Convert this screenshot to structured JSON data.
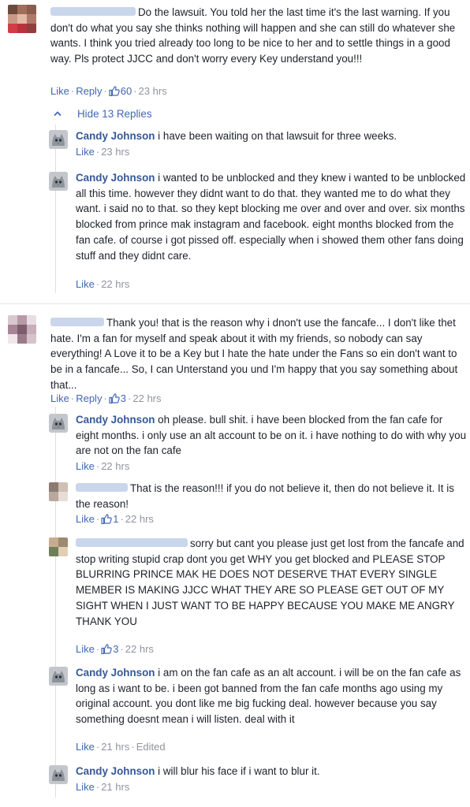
{
  "thread1": {
    "comment": {
      "text": "Do the lawsuit. You told her the last time it's the last warning. If you don't do what you say she thinks nothing will happen and she can still do whatever she wants. I think you tried already too long to be nice to her and to settle things in a good way. Pls protect JJCC and don't worry every Key understand you!!!",
      "like": "Like",
      "reply": "Reply",
      "likes": "60",
      "time": "23 hrs"
    },
    "hide_replies": "Hide 13 Replies",
    "replies": [
      {
        "author": "Candy Johnson",
        "text": "i have been waiting on that lawsuit for three weeks.",
        "like": "Like",
        "time": "23 hrs"
      },
      {
        "author": "Candy Johnson",
        "text": "i wanted to be unblocked and they knew i wanted to be unblocked all this time. however they didnt want to do that. they wanted me to do what they want. i said no to that. so they kept blocking me over and over and over. six months blocked from prince mak instagram and facebook. eight months blocked from the fan cafe. of course i got pissed off. especially when i showed them other fans doing stuff and they didnt care.",
        "like": "Like",
        "time": "22 hrs"
      }
    ]
  },
  "thread2": {
    "comment": {
      "text": "Thank you! that is the reason why i dnon't use the fancafe... I don't like thet hate. I'm a fan for myself and speak about it with my friends, so nobody can say everything! A Love it to be a Key but I hate the hate under the Fans so ein don't want to be in a fancafe... So, I can Unterstand you und I'm happy that you say something about that...",
      "like": "Like",
      "reply": "Reply",
      "likes": "3",
      "time": "22 hrs"
    },
    "replies": [
      {
        "author": "Candy Johnson",
        "text": "oh please. bull shit. i have been blocked from the fan cafe for eight months. i only use an alt account to be on it. i have nothing to do with why you are not on the fan cafe",
        "like": "Like",
        "time": "22 hrs"
      },
      {
        "author": "",
        "text": "That is the reason!!! if you do not believe it, then do not believe it. It is the reason!",
        "like": "Like",
        "likes": "1",
        "time": "22 hrs"
      },
      {
        "author": "",
        "text": "sorry but cant you please just get lost from the fancafe and stop writing stupid crap dont you get WHY you get blocked and PLEASE STOP BLURRING PRINCE MAK HE DOES NOT DESERVE THAT EVERY SINGLE MEMBER IS MAKING JJCC WHAT THEY ARE SO PLEASE GET OUT OF MY SIGHT WHEN I JUST WANT TO BE HAPPY BECAUSE YOU MAKE ME ANGRY THANK YOU",
        "like": "Like",
        "likes": "3",
        "time": "22 hrs"
      },
      {
        "author": "Candy Johnson",
        "text": "i am on the fan cafe as an alt account. i will be on the fan cafe as long as i want to be. i been got banned from the fan cafe months ago using my original account. you dont like me big fucking deal. however because you say something doesnt mean i will listen. deal with it",
        "like": "Like",
        "time": "21 hrs",
        "edited": "Edited"
      },
      {
        "author": "Candy Johnson",
        "text": "i will blur his face if i want to blur it.",
        "like": "Like",
        "time": "21 hrs"
      }
    ]
  },
  "colors": {
    "link": "#4267b2",
    "author": "#365899",
    "meta": "#90949c",
    "text": "#1d2129"
  },
  "icons": {
    "like": "thumbs-up-icon",
    "chevron": "chevron-up-icon",
    "avatar_candy": "cat-avatar-icon"
  }
}
